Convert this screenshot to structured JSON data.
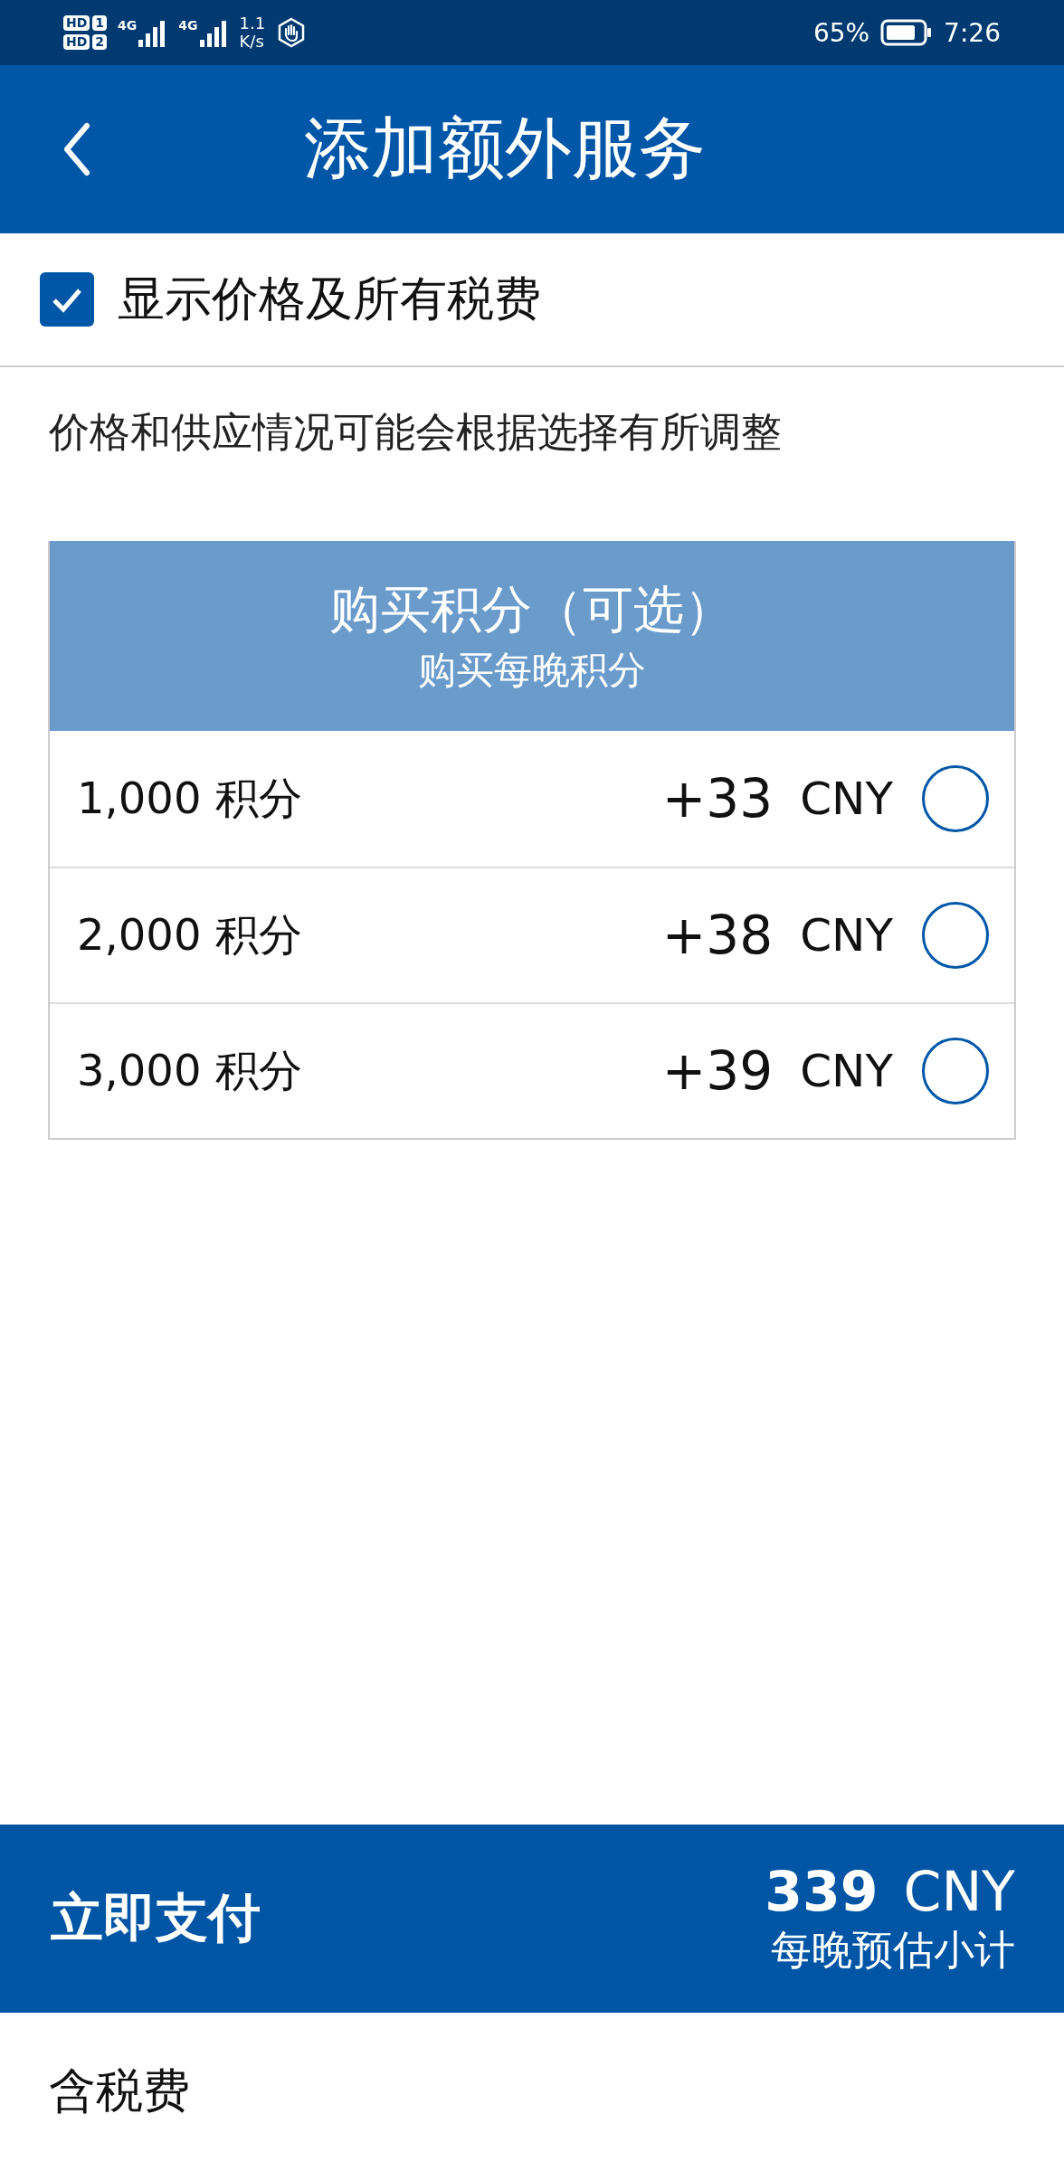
{
  "status_bar": {
    "sims": [
      {
        "badge": "HD",
        "slot": "1",
        "network": "4G"
      },
      {
        "badge": "HD",
        "slot": "2",
        "network": "4G"
      }
    ],
    "speed_value": "1.1",
    "speed_unit": "K/s",
    "battery": "65%",
    "time": "7:26"
  },
  "header": {
    "title": "添加额外服务"
  },
  "tax_toggle": {
    "label": "显示价格及所有税费",
    "checked": true
  },
  "notice": "价格和供应情况可能会根据选择有所调整",
  "points_card": {
    "title": "购买积分（可选）",
    "subtitle": "购买每晚积分",
    "options": [
      {
        "label": "1,000 积分",
        "price": "+33",
        "currency": "CNY",
        "selected": false
      },
      {
        "label": "2,000 积分",
        "price": "+38",
        "currency": "CNY",
        "selected": false
      },
      {
        "label": "3,000 积分",
        "price": "+39",
        "currency": "CNY",
        "selected": false
      }
    ]
  },
  "footer": {
    "pay_button": "立即支付",
    "total": "339",
    "currency": "CNY",
    "total_caption": "每晚预估小计"
  },
  "tax_note": "含税费"
}
